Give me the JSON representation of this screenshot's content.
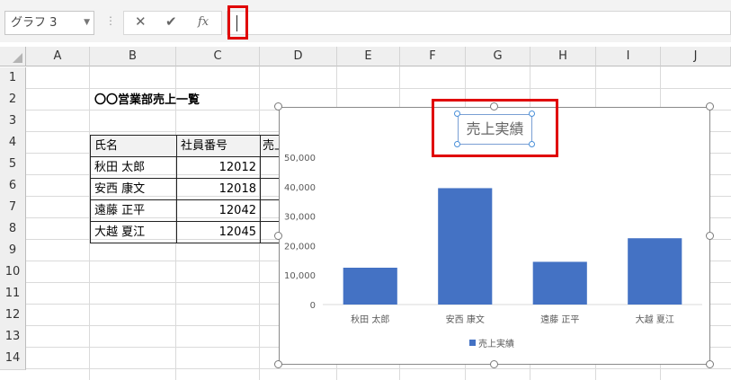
{
  "namebox": {
    "value": "グラフ 3",
    "dropdown_icon": "chevron-down-icon"
  },
  "formula_bar": {
    "cancel_icon": "✕",
    "enter_icon": "✔",
    "fx_icon": "fx",
    "value": ""
  },
  "columns": [
    "A",
    "B",
    "C",
    "D",
    "E",
    "F",
    "G",
    "H",
    "I",
    "J"
  ],
  "rows": [
    "1",
    "2",
    "3",
    "4",
    "5",
    "6",
    "7",
    "8",
    "9",
    "10",
    "11",
    "12",
    "13",
    "14"
  ],
  "sheet": {
    "title": "〇〇営業部売上一覧",
    "headers": [
      "氏名",
      "社員番号",
      "売上実績"
    ],
    "records": [
      {
        "name": "秋田 太郎",
        "id": "12012"
      },
      {
        "name": "安西 康文",
        "id": "12018"
      },
      {
        "name": "遠藤 正平",
        "id": "12042"
      },
      {
        "name": "大越 夏江",
        "id": "12045"
      }
    ]
  },
  "colors": {
    "bar": "#4472c4",
    "highlight": "#e00000",
    "selection": "#4a90d9"
  },
  "chart_data": {
    "type": "bar",
    "title": "売上実績",
    "categories": [
      "秋田 太郎",
      "安西 康文",
      "遠藤 正平",
      "大越 夏江"
    ],
    "series": [
      {
        "name": "売上実績",
        "values": [
          12500,
          39500,
          14500,
          22500
        ]
      }
    ],
    "yticks": [
      "0",
      "10,000",
      "20,000",
      "30,000",
      "40,000",
      "50,000"
    ],
    "ylim": [
      0,
      50000
    ],
    "legend": "bottom",
    "grid": false
  }
}
